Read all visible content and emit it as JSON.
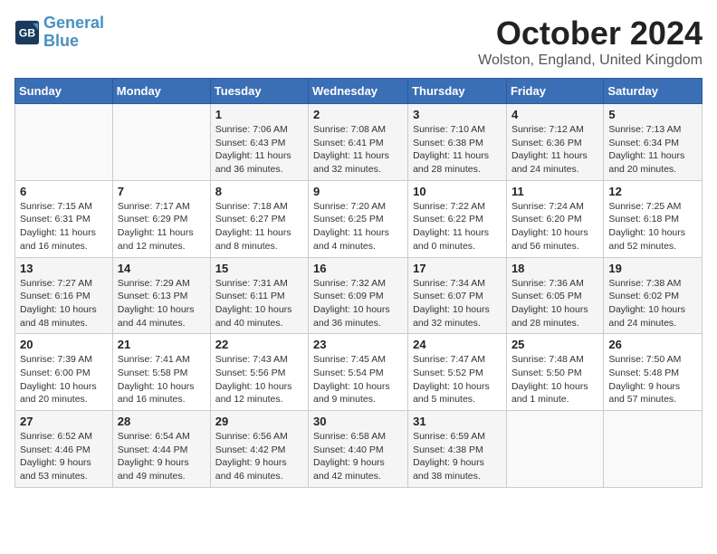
{
  "header": {
    "logo_line1": "General",
    "logo_line2": "Blue",
    "month": "October 2024",
    "location": "Wolston, England, United Kingdom"
  },
  "columns": [
    "Sunday",
    "Monday",
    "Tuesday",
    "Wednesday",
    "Thursday",
    "Friday",
    "Saturday"
  ],
  "weeks": [
    [
      {
        "day": "",
        "info": ""
      },
      {
        "day": "",
        "info": ""
      },
      {
        "day": "1",
        "info": "Sunrise: 7:06 AM\nSunset: 6:43 PM\nDaylight: 11 hours and 36 minutes."
      },
      {
        "day": "2",
        "info": "Sunrise: 7:08 AM\nSunset: 6:41 PM\nDaylight: 11 hours and 32 minutes."
      },
      {
        "day": "3",
        "info": "Sunrise: 7:10 AM\nSunset: 6:38 PM\nDaylight: 11 hours and 28 minutes."
      },
      {
        "day": "4",
        "info": "Sunrise: 7:12 AM\nSunset: 6:36 PM\nDaylight: 11 hours and 24 minutes."
      },
      {
        "day": "5",
        "info": "Sunrise: 7:13 AM\nSunset: 6:34 PM\nDaylight: 11 hours and 20 minutes."
      }
    ],
    [
      {
        "day": "6",
        "info": "Sunrise: 7:15 AM\nSunset: 6:31 PM\nDaylight: 11 hours and 16 minutes."
      },
      {
        "day": "7",
        "info": "Sunrise: 7:17 AM\nSunset: 6:29 PM\nDaylight: 11 hours and 12 minutes."
      },
      {
        "day": "8",
        "info": "Sunrise: 7:18 AM\nSunset: 6:27 PM\nDaylight: 11 hours and 8 minutes."
      },
      {
        "day": "9",
        "info": "Sunrise: 7:20 AM\nSunset: 6:25 PM\nDaylight: 11 hours and 4 minutes."
      },
      {
        "day": "10",
        "info": "Sunrise: 7:22 AM\nSunset: 6:22 PM\nDaylight: 11 hours and 0 minutes."
      },
      {
        "day": "11",
        "info": "Sunrise: 7:24 AM\nSunset: 6:20 PM\nDaylight: 10 hours and 56 minutes."
      },
      {
        "day": "12",
        "info": "Sunrise: 7:25 AM\nSunset: 6:18 PM\nDaylight: 10 hours and 52 minutes."
      }
    ],
    [
      {
        "day": "13",
        "info": "Sunrise: 7:27 AM\nSunset: 6:16 PM\nDaylight: 10 hours and 48 minutes."
      },
      {
        "day": "14",
        "info": "Sunrise: 7:29 AM\nSunset: 6:13 PM\nDaylight: 10 hours and 44 minutes."
      },
      {
        "day": "15",
        "info": "Sunrise: 7:31 AM\nSunset: 6:11 PM\nDaylight: 10 hours and 40 minutes."
      },
      {
        "day": "16",
        "info": "Sunrise: 7:32 AM\nSunset: 6:09 PM\nDaylight: 10 hours and 36 minutes."
      },
      {
        "day": "17",
        "info": "Sunrise: 7:34 AM\nSunset: 6:07 PM\nDaylight: 10 hours and 32 minutes."
      },
      {
        "day": "18",
        "info": "Sunrise: 7:36 AM\nSunset: 6:05 PM\nDaylight: 10 hours and 28 minutes."
      },
      {
        "day": "19",
        "info": "Sunrise: 7:38 AM\nSunset: 6:02 PM\nDaylight: 10 hours and 24 minutes."
      }
    ],
    [
      {
        "day": "20",
        "info": "Sunrise: 7:39 AM\nSunset: 6:00 PM\nDaylight: 10 hours and 20 minutes."
      },
      {
        "day": "21",
        "info": "Sunrise: 7:41 AM\nSunset: 5:58 PM\nDaylight: 10 hours and 16 minutes."
      },
      {
        "day": "22",
        "info": "Sunrise: 7:43 AM\nSunset: 5:56 PM\nDaylight: 10 hours and 12 minutes."
      },
      {
        "day": "23",
        "info": "Sunrise: 7:45 AM\nSunset: 5:54 PM\nDaylight: 10 hours and 9 minutes."
      },
      {
        "day": "24",
        "info": "Sunrise: 7:47 AM\nSunset: 5:52 PM\nDaylight: 10 hours and 5 minutes."
      },
      {
        "day": "25",
        "info": "Sunrise: 7:48 AM\nSunset: 5:50 PM\nDaylight: 10 hours and 1 minute."
      },
      {
        "day": "26",
        "info": "Sunrise: 7:50 AM\nSunset: 5:48 PM\nDaylight: 9 hours and 57 minutes."
      }
    ],
    [
      {
        "day": "27",
        "info": "Sunrise: 6:52 AM\nSunset: 4:46 PM\nDaylight: 9 hours and 53 minutes."
      },
      {
        "day": "28",
        "info": "Sunrise: 6:54 AM\nSunset: 4:44 PM\nDaylight: 9 hours and 49 minutes."
      },
      {
        "day": "29",
        "info": "Sunrise: 6:56 AM\nSunset: 4:42 PM\nDaylight: 9 hours and 46 minutes."
      },
      {
        "day": "30",
        "info": "Sunrise: 6:58 AM\nSunset: 4:40 PM\nDaylight: 9 hours and 42 minutes."
      },
      {
        "day": "31",
        "info": "Sunrise: 6:59 AM\nSunset: 4:38 PM\nDaylight: 9 hours and 38 minutes."
      },
      {
        "day": "",
        "info": ""
      },
      {
        "day": "",
        "info": ""
      }
    ]
  ]
}
